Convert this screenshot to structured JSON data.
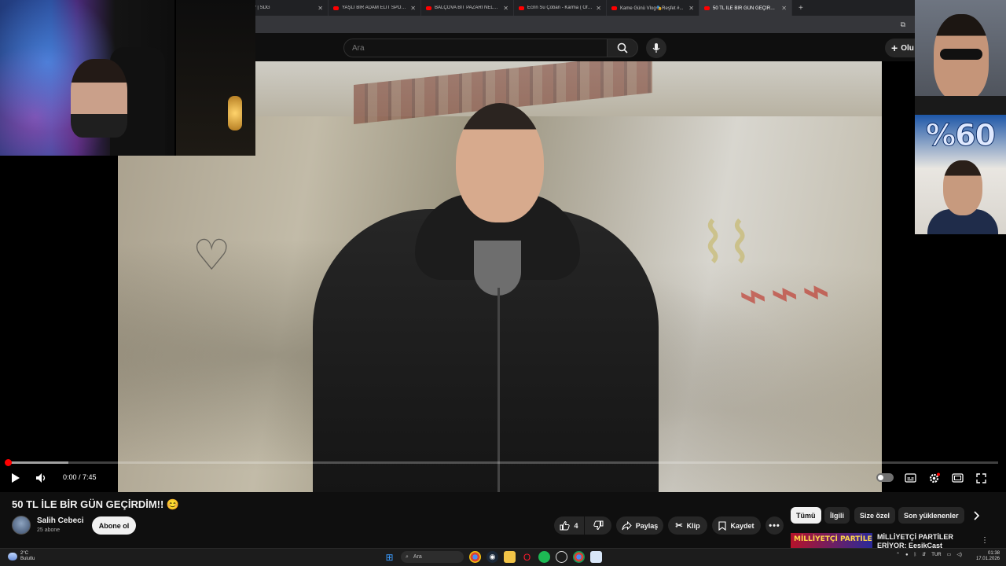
{
  "browser": {
    "tabs": [
      {
        "title": "or? | SDG"
      },
      {
        "title": "YAŞLI BİR ADAM ELİT SPORCU..."
      },
      {
        "title": "BALÇOVA BİT PAZARI NELER B..."
      },
      {
        "title": "Ecrin Su Çoban - Karma ( Offic..."
      },
      {
        "title": "Kame Günü Vlog🎭Reşfet #..."
      },
      {
        "title": "50 TL İLE BİR GÜN GEÇİRDİM!! 😊"
      }
    ]
  },
  "header": {
    "search_placeholder": "Ara",
    "create_label": "Olu"
  },
  "player": {
    "time": "0:00 / 7:45",
    "progress_fraction": 0.0,
    "buffer_fraction": 0.061
  },
  "overlay": {
    "promo_text": "%60"
  },
  "video": {
    "title": "50 TL İLE BİR GÜN GEÇİRDİM!! 😊",
    "channel": "Salih Cebeci",
    "subscribers": "25 abone",
    "subscribe_label": "Abone ol",
    "likes": "4",
    "share_label": "Paylaş",
    "clip_label": "Klip",
    "save_label": "Kaydet"
  },
  "filters": {
    "chips": [
      "Tümü",
      "İlgili",
      "Size özel",
      "Son yüklenenler"
    ],
    "active": "Tümü"
  },
  "recommendation": {
    "thumb_text": "MİLLİYETÇİ PARTİLER",
    "title": "MİLLİYETÇİ PARTİLER ERİYOR: EesikCast"
  },
  "taskbar": {
    "weather_temp": "2°C",
    "weather_desc": "Bulutlu",
    "search_label": "Ara",
    "lang": "TUR",
    "time": "01:38",
    "date": "17.01.2026"
  },
  "colors": {
    "accent": "#ff0000",
    "background": "#0f0f0f",
    "chip_bg": "#272727"
  }
}
